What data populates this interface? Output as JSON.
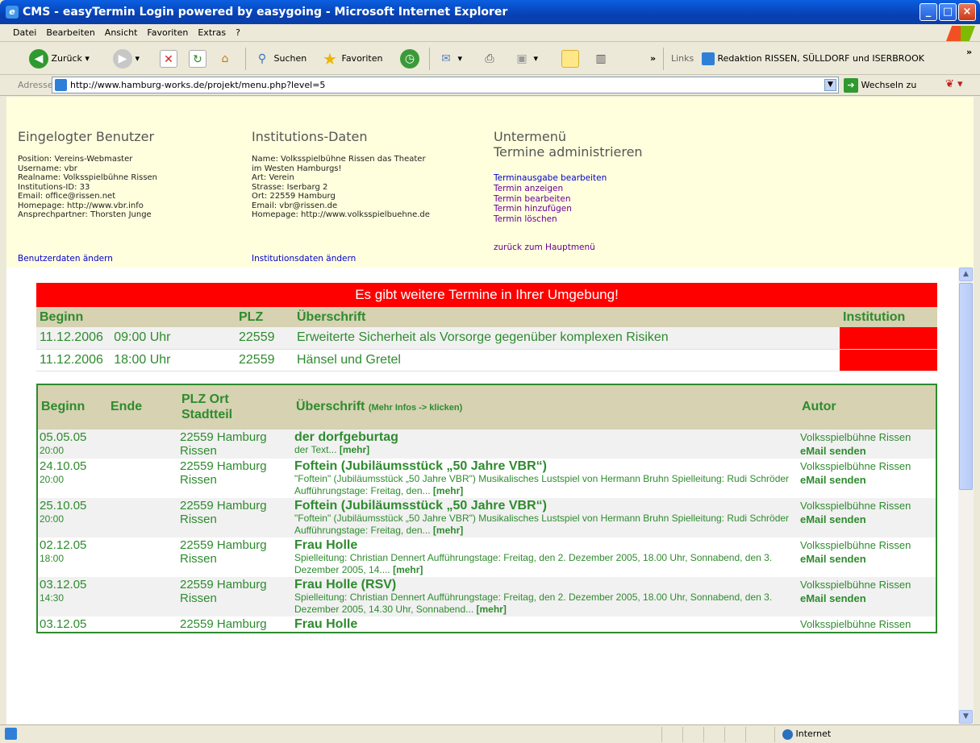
{
  "window": {
    "title": "CMS - easyTermin Login powered by easygoing - Microsoft Internet Explorer"
  },
  "menu": [
    "Datei",
    "Bearbeiten",
    "Ansicht",
    "Favoriten",
    "Extras",
    "?"
  ],
  "toolbar": {
    "back": "Zurück",
    "search": "Suchen",
    "favorites": "Favoriten",
    "links": "Links",
    "link_item": "Redaktion  RISSEN, SÜLLDORF und ISERBROOK"
  },
  "address": {
    "label": "Adresse",
    "url": "http://www.hamburg-works.de/projekt/menu.php?level=5",
    "go": "Wechseln zu"
  },
  "user": {
    "heading": "Eingelogter Benutzer",
    "lines": [
      "Position: Vereins-Webmaster",
      "Username: vbr",
      "Realname: Volksspielbühne Rissen",
      "Institutions-ID: 33",
      "Email: office@rissen.net",
      "Homepage: http://www.vbr.info",
      "Ansprechpartner: Thorsten Junge"
    ],
    "edit_link": "Benutzerdaten ändern"
  },
  "institution": {
    "heading": "Institutions-Daten",
    "lines": [
      "Name: Volksspielbühne Rissen das Theater",
      "im Westen Hamburgs!",
      "Art: Verein",
      "Strasse: Iserbarg 2",
      "Ort: 22559 Hamburg",
      "Email: vbr@rissen.de",
      "Homepage: http://www.volksspielbuehne.de"
    ],
    "edit_link": "Institutionsdaten ändern"
  },
  "submenu": {
    "heading1": "Untermenü",
    "heading2": "Termine administrieren",
    "links": [
      "Terminausgabe bearbeiten",
      "Termin anzeigen",
      "Termin bearbeiten",
      "Termin hinzufügen",
      "Termin löschen"
    ],
    "back": "zurück zum Hauptmenü"
  },
  "banner": "Es gibt weitere Termine in Ihrer Umgebung!",
  "nearby": {
    "headers": [
      "Beginn",
      "PLZ",
      "Überschrift",
      "Institution"
    ],
    "rows": [
      {
        "date": "11.12.2006",
        "time": "09:00 Uhr",
        "plz": "22559",
        "title": "Erweiterte Sicherheit als Vorsorge gegenüber komplexen Risiken"
      },
      {
        "date": "11.12.2006",
        "time": "18:00 Uhr",
        "plz": "22559",
        "title": "Hänsel und Gretel"
      }
    ],
    "institution_color": "#ff0000"
  },
  "events": {
    "headers": {
      "beginn": "Beginn",
      "ende": "Ende",
      "plz1": "PLZ Ort",
      "plz2": "Stadtteil",
      "title": "Überschrift",
      "title_hint": "(Mehr Infos -> klicken)",
      "author": "Autor"
    },
    "rows": [
      {
        "date": "05.05.05",
        "time": "20:00",
        "city": "22559 Hamburg",
        "district": "Rissen",
        "title": "der dorfgeburtag",
        "desc": "der Text...",
        "more": "[mehr]",
        "author": "Volksspielbühne Rissen",
        "mail": "eMail senden"
      },
      {
        "date": "24.10.05",
        "time": "20:00",
        "city": "22559 Hamburg",
        "district": "Rissen",
        "title": "Foftein (Jubiläumsstück „50 Jahre VBR“)",
        "desc": "\"Foftein\" (Jubiläumsstück „50 Jahre VBR\") Musikalisches Lustspiel von Hermann Bruhn Spielleitung: Rudi Schröder Aufführungstage: Freitag, den...",
        "more": "[mehr]",
        "author": "Volksspielbühne Rissen",
        "mail": "eMail senden"
      },
      {
        "date": "25.10.05",
        "time": "20:00",
        "city": "22559 Hamburg",
        "district": "Rissen",
        "title": "Foftein (Jubiläumsstück „50 Jahre VBR“)",
        "desc": "\"Foftein\" (Jubiläumsstück „50 Jahre VBR\") Musikalisches Lustspiel von Hermann Bruhn Spielleitung: Rudi Schröder Aufführungstage: Freitag, den...",
        "more": "[mehr]",
        "author": "Volksspielbühne Rissen",
        "mail": "eMail senden"
      },
      {
        "date": "02.12.05",
        "time": "18:00",
        "city": "22559 Hamburg",
        "district": "Rissen",
        "title": "Frau Holle",
        "desc": "Spielleitung: Christian Dennert Aufführungstage: Freitag, den 2. Dezember 2005, 18.00 Uhr, Sonnabend, den 3. Dezember 2005, 14....",
        "more": "[mehr]",
        "author": "Volksspielbühne Rissen",
        "mail": "eMail senden"
      },
      {
        "date": "03.12.05",
        "time": "14:30",
        "city": "22559 Hamburg",
        "district": "Rissen",
        "title": "Frau Holle (RSV)",
        "desc": "Spielleitung: Christian Dennert Aufführungstage: Freitag, den 2. Dezember 2005, 18.00 Uhr, Sonnabend, den 3. Dezember 2005, 14.30 Uhr, Sonnabend...",
        "more": "[mehr]",
        "author": "Volksspielbühne Rissen",
        "mail": "eMail senden"
      },
      {
        "date": "03.12.05",
        "time": "",
        "city": "22559 Hamburg",
        "district": "",
        "title": "Frau Holle",
        "desc": "",
        "more": "",
        "author": "Volksspielbühne Rissen",
        "mail": ""
      }
    ]
  },
  "status": {
    "zone": "Internet"
  }
}
